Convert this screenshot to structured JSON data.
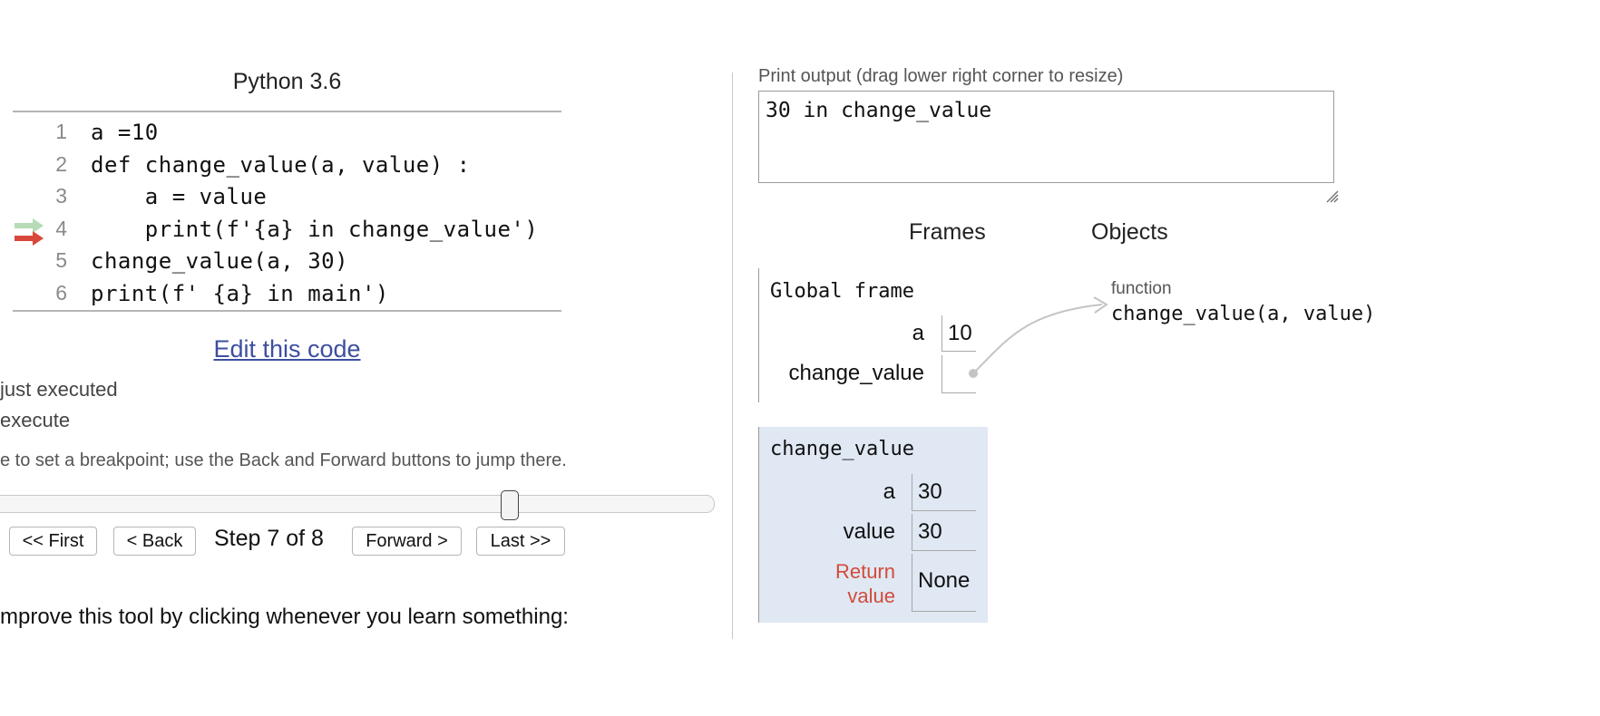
{
  "code_panel": {
    "language": "Python 3.6",
    "lines": [
      {
        "no": "1",
        "text": "a =10"
      },
      {
        "no": "2",
        "text": "def change_value(a, value) :"
      },
      {
        "no": "3",
        "text": "    a = value"
      },
      {
        "no": "4",
        "text": "    print(f'{a} in change_value')"
      },
      {
        "no": "5",
        "text": "change_value(a, 30)"
      },
      {
        "no": "6",
        "text": "print(f' {a} in main')"
      }
    ],
    "arrow_colors": {
      "just_executed": "#b6dbb6",
      "next_to_execute": "#d9473a"
    },
    "edit_link": "Edit this code",
    "legend_just_executed": "just executed",
    "legend_next": "execute",
    "breakpoint_hint": "e to set a breakpoint; use the Back and Forward buttons to jump there."
  },
  "navigation": {
    "first": "<< First",
    "back": "< Back",
    "step_counter": "Step 7 of 8",
    "forward": "Forward >",
    "last": "Last >>",
    "slider_progress": 0.72
  },
  "feedback_text": "mprove this tool by clicking whenever you learn something:",
  "output": {
    "label": "Print output (drag lower right corner to resize)",
    "text": "30 in change_value"
  },
  "visualizer": {
    "frames_header": "Frames",
    "objects_header": "Objects",
    "global_frame": {
      "title": "Global frame",
      "vars": [
        {
          "name": "a",
          "value": "10"
        },
        {
          "name": "change_value",
          "value": ""
        }
      ]
    },
    "function_frame": {
      "title": "change_value",
      "vars": [
        {
          "name": "a",
          "value": "30"
        },
        {
          "name": "value",
          "value": "30"
        }
      ],
      "return_label_line1": "Return",
      "return_label_line2": "value",
      "return_value": "None",
      "background_color": "#dfe8f3"
    },
    "function_object": {
      "type_label": "function",
      "signature": "change_value(a, value)"
    }
  }
}
